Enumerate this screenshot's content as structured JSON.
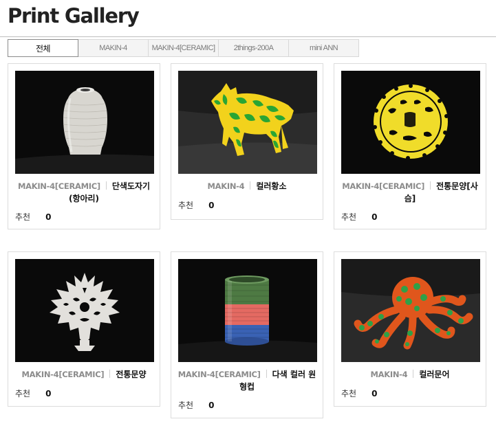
{
  "header": {
    "title": "Print Gallery"
  },
  "tabs": [
    {
      "label": "전체",
      "active": true
    },
    {
      "label": "MAKIN-4",
      "active": false
    },
    {
      "label": "MAKIN-4[CERAMIC]",
      "active": false
    },
    {
      "label": "2things-200A",
      "active": false
    },
    {
      "label": "mini ANN",
      "active": false
    }
  ],
  "gallery": {
    "recommend_label": "추천",
    "items": [
      {
        "model": "MAKIN-4[CERAMIC]",
        "name": "단색도자기(항아리)",
        "count": "0",
        "image": "white-ceramic-jar"
      },
      {
        "model": "MAKIN-4",
        "name": "컬러황소",
        "count": "0",
        "image": "colored-bull"
      },
      {
        "model": "MAKIN-4[CERAMIC]",
        "name": "전통문양[사슴]",
        "count": "0",
        "image": "yellow-deer-medallion"
      },
      {
        "model": "MAKIN-4[CERAMIC]",
        "name": "전통문양",
        "count": "0",
        "image": "white-ornament"
      },
      {
        "model": "MAKIN-4[CERAMIC]",
        "name": "다색 컬러 원형컵",
        "count": "0",
        "image": "striped-cup"
      },
      {
        "model": "MAKIN-4",
        "name": "컬러문어",
        "count": "0",
        "image": "colored-octopus"
      }
    ]
  },
  "colors": {
    "accent_border": "#8a8a8a",
    "card_border": "#dcdcdc",
    "model_text": "#8c8c8c"
  }
}
